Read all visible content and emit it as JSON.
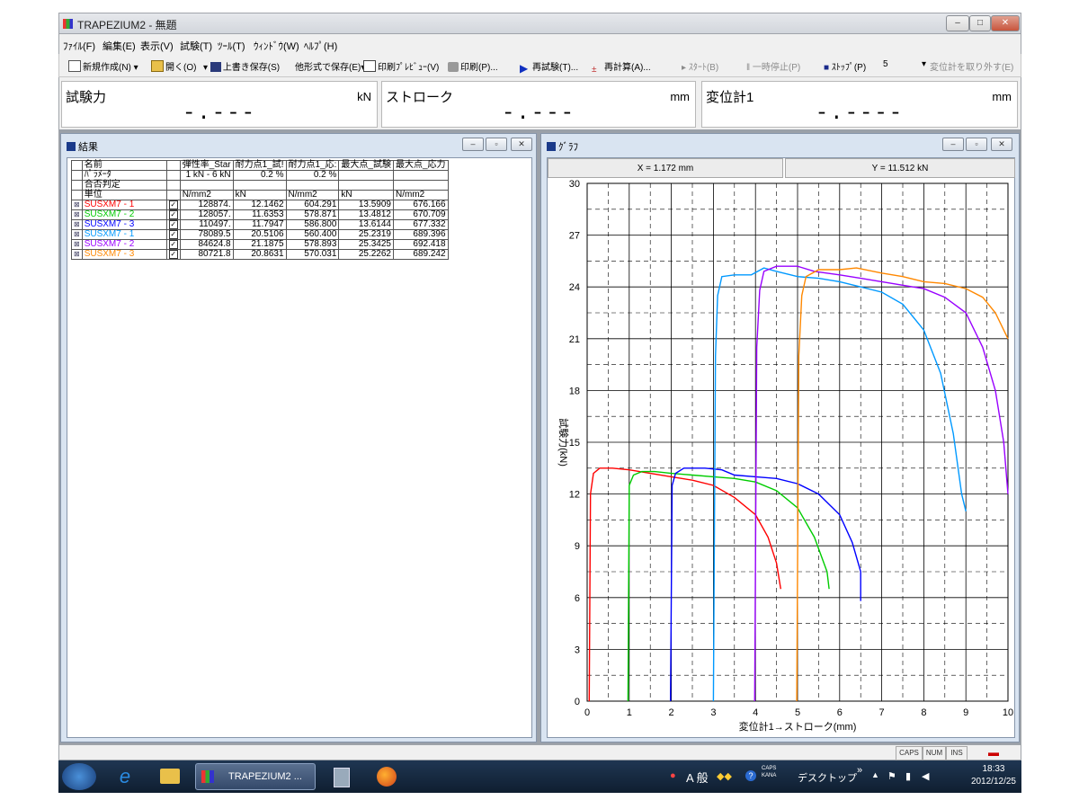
{
  "window": {
    "title": "TRAPEZIUM2 - 無題"
  },
  "menu": [
    "ﾌｧｲﾙ(F)",
    "編集(E)",
    "表示(V)",
    "試験(T)",
    "ﾂｰﾙ(T)",
    "ｳｨﾝﾄﾞｳ(W)",
    "ﾍﾙﾌﾟ(H)"
  ],
  "toolbar": {
    "new": "新規作成(N)",
    "open": "開く(O)",
    "save": "上書き保存(S)",
    "save_as": "他形式で保存(E)",
    "preview": "印刷ﾌﾟﾚﾋﾞｭｰ(V)",
    "print": "印刷(P)...",
    "retest": "再試験(T)...",
    "recalc": "再計算(A)...",
    "start": "ｽﾀｰﾄ(B)",
    "pause": "一時停止(P)",
    "stop": "ｽﾄｯﾌﾟ(P)",
    "speed": "5",
    "remove": "変位計を取り外す(E)"
  },
  "readouts": [
    {
      "label": "試験力",
      "value": "-.---",
      "unit": "kN"
    },
    {
      "label": "ストローク",
      "value": "-.---",
      "unit": "mm"
    },
    {
      "label": "変位計1",
      "value": "-.----",
      "unit": "mm"
    }
  ],
  "results_window": {
    "title": "結果",
    "header_rows": [
      [
        "",
        "名前",
        "",
        "弾性率_Star",
        "耐力点1_試!",
        "耐力点1_応:",
        "最大点_試験",
        "最大点_応力"
      ],
      [
        "",
        "ﾊﾟﾗﾒｰﾀ",
        "",
        "1 kN - 6 kN",
        "0.2 %",
        "0.2 %",
        "",
        ""
      ],
      [
        "",
        "合否判定",
        "",
        "",
        "",
        "",
        "",
        ""
      ],
      [
        "",
        "単位",
        "",
        "N/mm2",
        "kN",
        "N/mm2",
        "kN",
        "N/mm2"
      ]
    ],
    "rows": [
      {
        "name": "SUSXM7 - 1",
        "color": "#ff0000",
        "values": [
          "128874.",
          "12.1462",
          "604.291",
          "13.5909",
          "676.166"
        ]
      },
      {
        "name": "SUSXM7 - 2",
        "color": "#00cc00",
        "values": [
          "128057.",
          "11.6353",
          "578.871",
          "13.4812",
          "670.709"
        ]
      },
      {
        "name": "SUSXM7 - 3",
        "color": "#0000ff",
        "values": [
          "110497.",
          "11.7947",
          "586.800",
          "13.6144",
          "677.332"
        ]
      },
      {
        "name": "SUSXM7 - 1",
        "color": "#0099ff",
        "values": [
          "78089.5",
          "20.5106",
          "560.400",
          "25.2319",
          "689.396"
        ]
      },
      {
        "name": "SUSXM7 - 2",
        "color": "#9900ff",
        "values": [
          "84624.8",
          "21.1875",
          "578.893",
          "25.3425",
          "692.418"
        ]
      },
      {
        "name": "SUSXM7 - 3",
        "color": "#ff8800",
        "values": [
          "80721.8",
          "20.8631",
          "570.031",
          "25.2262",
          "689.242"
        ]
      }
    ]
  },
  "graph_window": {
    "title": "ｸﾞﾗﾌ",
    "x_readout": "X = 1.172 mm",
    "y_readout": "Y = 11.512 kN"
  },
  "chart_data": {
    "type": "line",
    "xlabel": "変位計1→ストローク(mm)",
    "ylabel": "試験力(kN)",
    "xlim": [
      0,
      10
    ],
    "ylim": [
      0,
      30
    ],
    "xticks": [
      0,
      1,
      2,
      3,
      4,
      5,
      6,
      7,
      8,
      9,
      10
    ],
    "yticks": [
      0,
      3,
      6,
      9,
      12,
      15,
      18,
      21,
      24,
      27,
      30
    ],
    "grid": true,
    "series": [
      {
        "color": "#ff0000",
        "points": [
          [
            0.05,
            0
          ],
          [
            0.08,
            12.0
          ],
          [
            0.15,
            13.2
          ],
          [
            0.3,
            13.5
          ],
          [
            0.6,
            13.5
          ],
          [
            1.0,
            13.4
          ],
          [
            1.5,
            13.2
          ],
          [
            2.0,
            13.0
          ],
          [
            2.5,
            12.8
          ],
          [
            3.0,
            12.5
          ],
          [
            3.5,
            11.8
          ],
          [
            4.0,
            10.8
          ],
          [
            4.3,
            9.5
          ],
          [
            4.5,
            8.0
          ],
          [
            4.6,
            6.5
          ]
        ]
      },
      {
        "color": "#00cc00",
        "points": [
          [
            0.97,
            0
          ],
          [
            1.0,
            12.5
          ],
          [
            1.1,
            13.1
          ],
          [
            1.3,
            13.3
          ],
          [
            1.6,
            13.3
          ],
          [
            2.0,
            13.2
          ],
          [
            2.5,
            13.1
          ],
          [
            3.0,
            13.0
          ],
          [
            3.5,
            12.9
          ],
          [
            4.0,
            12.7
          ],
          [
            4.5,
            12.2
          ],
          [
            5.0,
            11.2
          ],
          [
            5.4,
            9.5
          ],
          [
            5.7,
            7.5
          ],
          [
            5.75,
            6.5
          ]
        ]
      },
      {
        "color": "#0000ff",
        "points": [
          [
            1.98,
            0
          ],
          [
            2.02,
            12.5
          ],
          [
            2.1,
            13.2
          ],
          [
            2.3,
            13.5
          ],
          [
            2.8,
            13.5
          ],
          [
            3.2,
            13.4
          ],
          [
            3.5,
            13.1
          ],
          [
            4.0,
            13.0
          ],
          [
            4.5,
            12.9
          ],
          [
            5.0,
            12.6
          ],
          [
            5.5,
            12.0
          ],
          [
            6.0,
            10.8
          ],
          [
            6.3,
            9.2
          ],
          [
            6.5,
            7.5
          ],
          [
            6.5,
            5.8
          ]
        ]
      },
      {
        "color": "#0099ff",
        "points": [
          [
            3.0,
            0
          ],
          [
            3.05,
            20.0
          ],
          [
            3.1,
            23.5
          ],
          [
            3.2,
            24.6
          ],
          [
            3.5,
            24.7
          ],
          [
            3.9,
            24.7
          ],
          [
            4.2,
            25.1
          ],
          [
            4.5,
            24.9
          ],
          [
            5.0,
            24.6
          ],
          [
            5.5,
            24.5
          ],
          [
            6.0,
            24.3
          ],
          [
            6.5,
            24.0
          ],
          [
            7.0,
            23.7
          ],
          [
            7.5,
            23.0
          ],
          [
            8.0,
            21.5
          ],
          [
            8.4,
            19.0
          ],
          [
            8.7,
            15.5
          ],
          [
            8.9,
            12.0
          ],
          [
            9.0,
            11.0
          ]
        ]
      },
      {
        "color": "#9900ff",
        "points": [
          [
            3.98,
            0
          ],
          [
            4.03,
            20.5
          ],
          [
            4.1,
            23.8
          ],
          [
            4.2,
            24.9
          ],
          [
            4.5,
            25.2
          ],
          [
            5.0,
            25.2
          ],
          [
            5.4,
            24.9
          ],
          [
            6.0,
            24.7
          ],
          [
            6.5,
            24.5
          ],
          [
            7.0,
            24.3
          ],
          [
            7.5,
            24.1
          ],
          [
            8.0,
            23.9
          ],
          [
            8.5,
            23.4
          ],
          [
            9.0,
            22.5
          ],
          [
            9.4,
            20.5
          ],
          [
            9.7,
            18.0
          ],
          [
            9.9,
            15.0
          ],
          [
            10.0,
            12.0
          ]
        ]
      },
      {
        "color": "#ff8800",
        "points": [
          [
            4.98,
            0
          ],
          [
            5.03,
            20.0
          ],
          [
            5.1,
            23.5
          ],
          [
            5.2,
            24.6
          ],
          [
            5.5,
            25.0
          ],
          [
            6.0,
            25.0
          ],
          [
            6.4,
            25.1
          ],
          [
            7.0,
            24.8
          ],
          [
            7.5,
            24.6
          ],
          [
            8.0,
            24.3
          ],
          [
            8.5,
            24.2
          ],
          [
            9.0,
            23.9
          ],
          [
            9.4,
            23.4
          ],
          [
            9.7,
            22.5
          ],
          [
            9.9,
            21.5
          ],
          [
            10.0,
            21.0
          ]
        ]
      }
    ]
  },
  "status": {
    "caps": "CAPS",
    "num": "NUM",
    "ins": "INS"
  },
  "taskbar": {
    "app": "TRAPEZIUM2 ...",
    "ime": "A 般",
    "desktop": "デスクトップ",
    "caps_kana": "CAPS KANA",
    "time": "18:33",
    "date": "2012/12/25"
  }
}
